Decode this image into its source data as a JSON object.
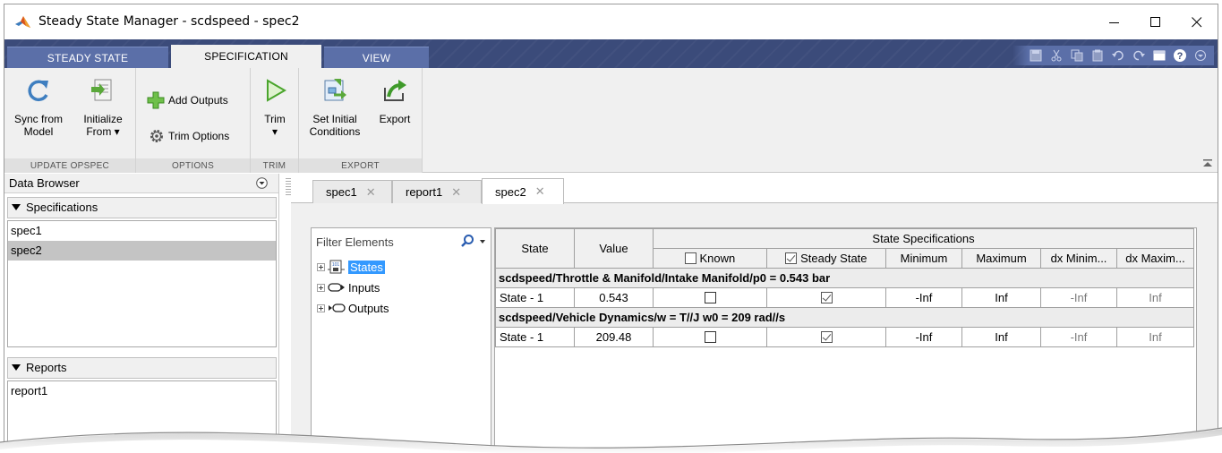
{
  "window": {
    "title": "Steady State Manager - scdspeed - spec2",
    "icon": "matlab-logo-icon",
    "controls": [
      "minimize-icon",
      "maximize-icon",
      "close-icon"
    ]
  },
  "ribbon_tabs": [
    {
      "label": "STEADY STATE",
      "active": false
    },
    {
      "label": "SPECIFICATION",
      "active": true
    },
    {
      "label": "VIEW",
      "active": false
    }
  ],
  "quick_access": [
    "save-icon",
    "cut-icon",
    "copy-icon",
    "paste-icon",
    "undo-icon",
    "redo-icon",
    "window-icon",
    "help-icon",
    "options-icon"
  ],
  "ribbon": {
    "groups": [
      {
        "label": "UPDATE OPSPEC"
      },
      {
        "label": "OPTIONS"
      },
      {
        "label": "TRIM"
      },
      {
        "label": "EXPORT"
      }
    ],
    "sync_line1": "Sync from",
    "sync_line2": "Model",
    "init_line1": "Initialize",
    "init_line2": "From ▾",
    "add_outputs": "Add Outputs",
    "trim_options": "Trim Options",
    "trim_line1": "Trim",
    "trim_line2": "▾",
    "setinit_line1": "Set Initial",
    "setinit_line2": "Conditions",
    "export": "Export"
  },
  "data_browser": {
    "title": "Data Browser",
    "specifications_header": "Specifications",
    "specifications": [
      {
        "label": "spec1",
        "selected": false
      },
      {
        "label": "spec2",
        "selected": true
      }
    ],
    "reports_header": "Reports",
    "reports": [
      {
        "label": "report1"
      }
    ]
  },
  "doc_tabs": [
    {
      "label": "spec1",
      "active": false
    },
    {
      "label": "report1",
      "active": false
    },
    {
      "label": "spec2",
      "active": true
    }
  ],
  "filter": {
    "placeholder": "Filter Elements",
    "tree": [
      {
        "label": "States",
        "icon": "states-icon",
        "selected": true
      },
      {
        "label": "Inputs",
        "icon": "input-port-icon",
        "selected": false
      },
      {
        "label": "Outputs",
        "icon": "output-port-icon",
        "selected": false
      }
    ]
  },
  "spec_table": {
    "col_state": "State",
    "col_value": "Value",
    "group_header": "State Specifications",
    "col_known": "Known",
    "col_steady": "Steady State",
    "col_min": "Minimum",
    "col_max": "Maximum",
    "col_dxmin": "dx Minim...",
    "col_dxmax": "dx Maxim...",
    "known_header_checked": false,
    "steady_header_checked": true,
    "blocks": [
      {
        "path": "scdspeed/Throttle & Manifold/Intake Manifold/p0 = 0.543 bar",
        "row": {
          "state": "State - 1",
          "value": "0.543",
          "known": false,
          "steady": true,
          "min": "-Inf",
          "max": "Inf",
          "dxmin": "-Inf",
          "dxmax": "Inf"
        }
      },
      {
        "path": "scdspeed/Vehicle Dynamics/w = T//J w0 = 209 rad//s",
        "row": {
          "state": "State - 1",
          "value": "209.48",
          "known": false,
          "steady": true,
          "min": "-Inf",
          "max": "Inf",
          "dxmin": "-Inf",
          "dxmax": "Inf"
        }
      }
    ]
  }
}
